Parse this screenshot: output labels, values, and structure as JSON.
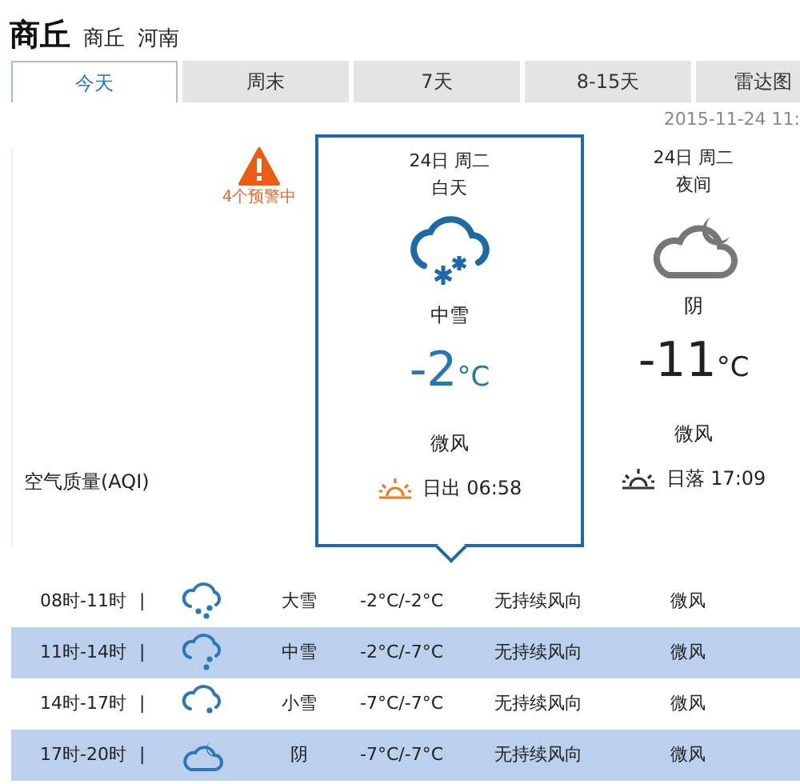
{
  "header": {
    "city": "商丘",
    "district": "商丘",
    "province": "河南"
  },
  "tabs": [
    {
      "label": "今天",
      "selected": true
    },
    {
      "label": "周末",
      "selected": false
    },
    {
      "label": "7天",
      "selected": false
    },
    {
      "label": "8-15天",
      "selected": false
    },
    {
      "label": "雷达图",
      "selected": false
    }
  ],
  "updated": "2015-11-24 11:",
  "alert": {
    "text": "4个预警中"
  },
  "aqi_label": "空气质量(AQI)",
  "periods": [
    {
      "date": "24日 周二",
      "part": "白天",
      "kind": "snow",
      "weather": "中雪",
      "temp": "-2",
      "unit": "°C",
      "wind": "微风",
      "sun": {
        "kind": "sunrise",
        "text": "日出 06:58"
      },
      "selected": true
    },
    {
      "date": "24日 周二",
      "part": "夜间",
      "kind": "cloudy-night",
      "weather": "阴",
      "temp": "-11",
      "unit": "°C",
      "wind": "微风",
      "sun": {
        "kind": "sunset",
        "text": "日落 17:09"
      },
      "selected": false
    }
  ],
  "hours": [
    {
      "time": "08时-11时",
      "sep": "|",
      "kind": "heavy-snow",
      "weather": "大雪",
      "temp": "-2°C/-2°C",
      "wind_dir": "无持续风向",
      "wind": "微风"
    },
    {
      "time": "11时-14时",
      "sep": "|",
      "kind": "moderate-snow",
      "weather": "中雪",
      "temp": "-2°C/-7°C",
      "wind_dir": "无持续风向",
      "wind": "微风"
    },
    {
      "time": "14时-17时",
      "sep": "|",
      "kind": "light-snow",
      "weather": "小雪",
      "temp": "-7°C/-7°C",
      "wind_dir": "无持续风向",
      "wind": "微风"
    },
    {
      "time": "17时-20时",
      "sep": "|",
      "kind": "cloudy-night",
      "weather": "阴",
      "temp": "-7°C/-7°C",
      "wind_dir": "无持续风向",
      "wind": "微风"
    }
  ]
}
